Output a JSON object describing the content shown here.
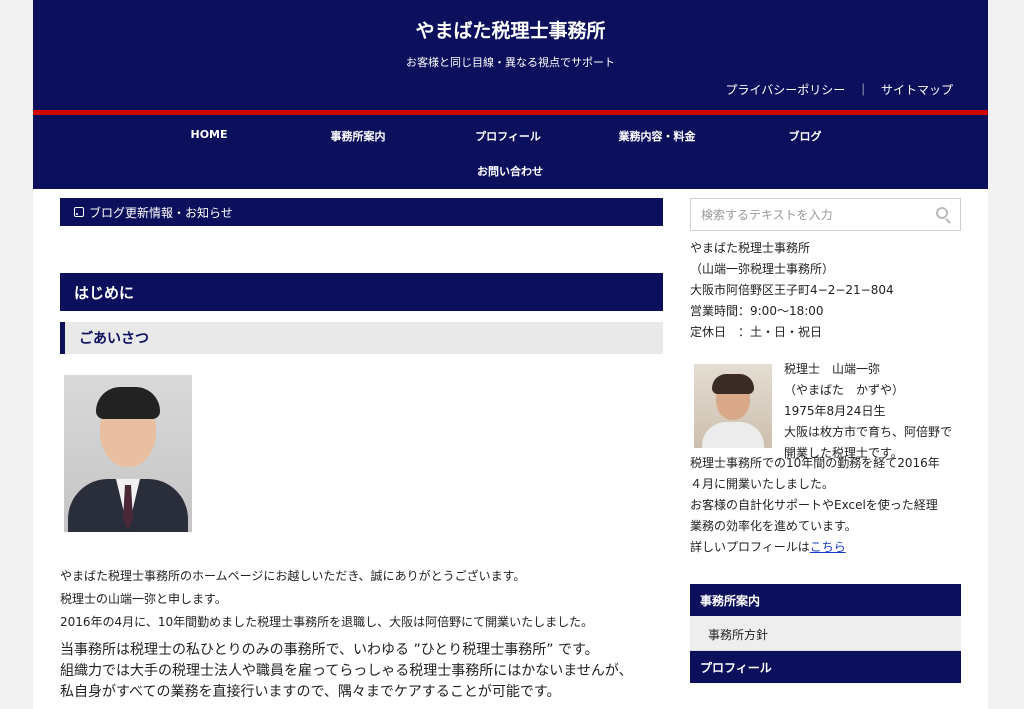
{
  "header": {
    "site_title": "やまばた税理士事務所",
    "tagline": "お客様と同じ目線・異なる視点でサポート",
    "util_links": [
      "プライバシーポリシー",
      "サイトマップ"
    ],
    "util_separator": "｜"
  },
  "nav": {
    "items": [
      "HOME",
      "事務所案内",
      "プロフィール",
      "業務内容・料金",
      "ブログ",
      "お問い合わせ"
    ]
  },
  "main": {
    "blog_bar": "ブログ更新情報・お知らせ",
    "heading": "はじめに",
    "subheading": "ごあいさつ",
    "para1": [
      "やまばた税理士事務所のホームページにお越しいただき、誠にありがとうございます。",
      "税理士の山端一弥と申します。",
      "2016年の4月に、10年間勤めました税理士事務所を退職し、大阪は阿倍野にて開業いたしました。"
    ],
    "para2": [
      "当事務所は税理士の私ひとりのみの事務所で、いわゆる ”ひとり税理士事務所” です。",
      "組織力では大手の税理士法人や職員を雇ってらっしゃる税理士事務所にはかないませんが、",
      "私自身がすべての業務を直接行いますので、隅々までケアすることが可能です。"
    ]
  },
  "sidebar": {
    "search_placeholder": "検索するテキストを入力",
    "office": [
      "やまばた税理士事務所",
      "（山端一弥税理士事務所）",
      "大阪市阿倍野区王子町4−2−21−804",
      "営業時間：9:00〜18:00",
      "定休日　：土・日・祝日"
    ],
    "profile_lines": [
      "税理士　山端一弥",
      "（やまばた　かずや）",
      "1975年8月24日生",
      "大阪は枚方市で育ち、阿倍野で",
      "開業した税理士です。"
    ],
    "profile_rest": [
      "税理士事務所での10年間の勤務を経て2016年",
      "４月に開業いたしました。",
      "お客様の自計化サポートやExcelを使った経理",
      "業務の効率化を進めています。"
    ],
    "profile_more_prefix": "詳しいプロフィールは",
    "profile_more_link": "こちら",
    "box1_title": "事務所案内",
    "box1_item": "事務所方針",
    "box2_title": "プロフィール"
  },
  "colors": {
    "navy": "#0c0f5c",
    "red": "#d40000",
    "link": "#1a3cc8"
  }
}
